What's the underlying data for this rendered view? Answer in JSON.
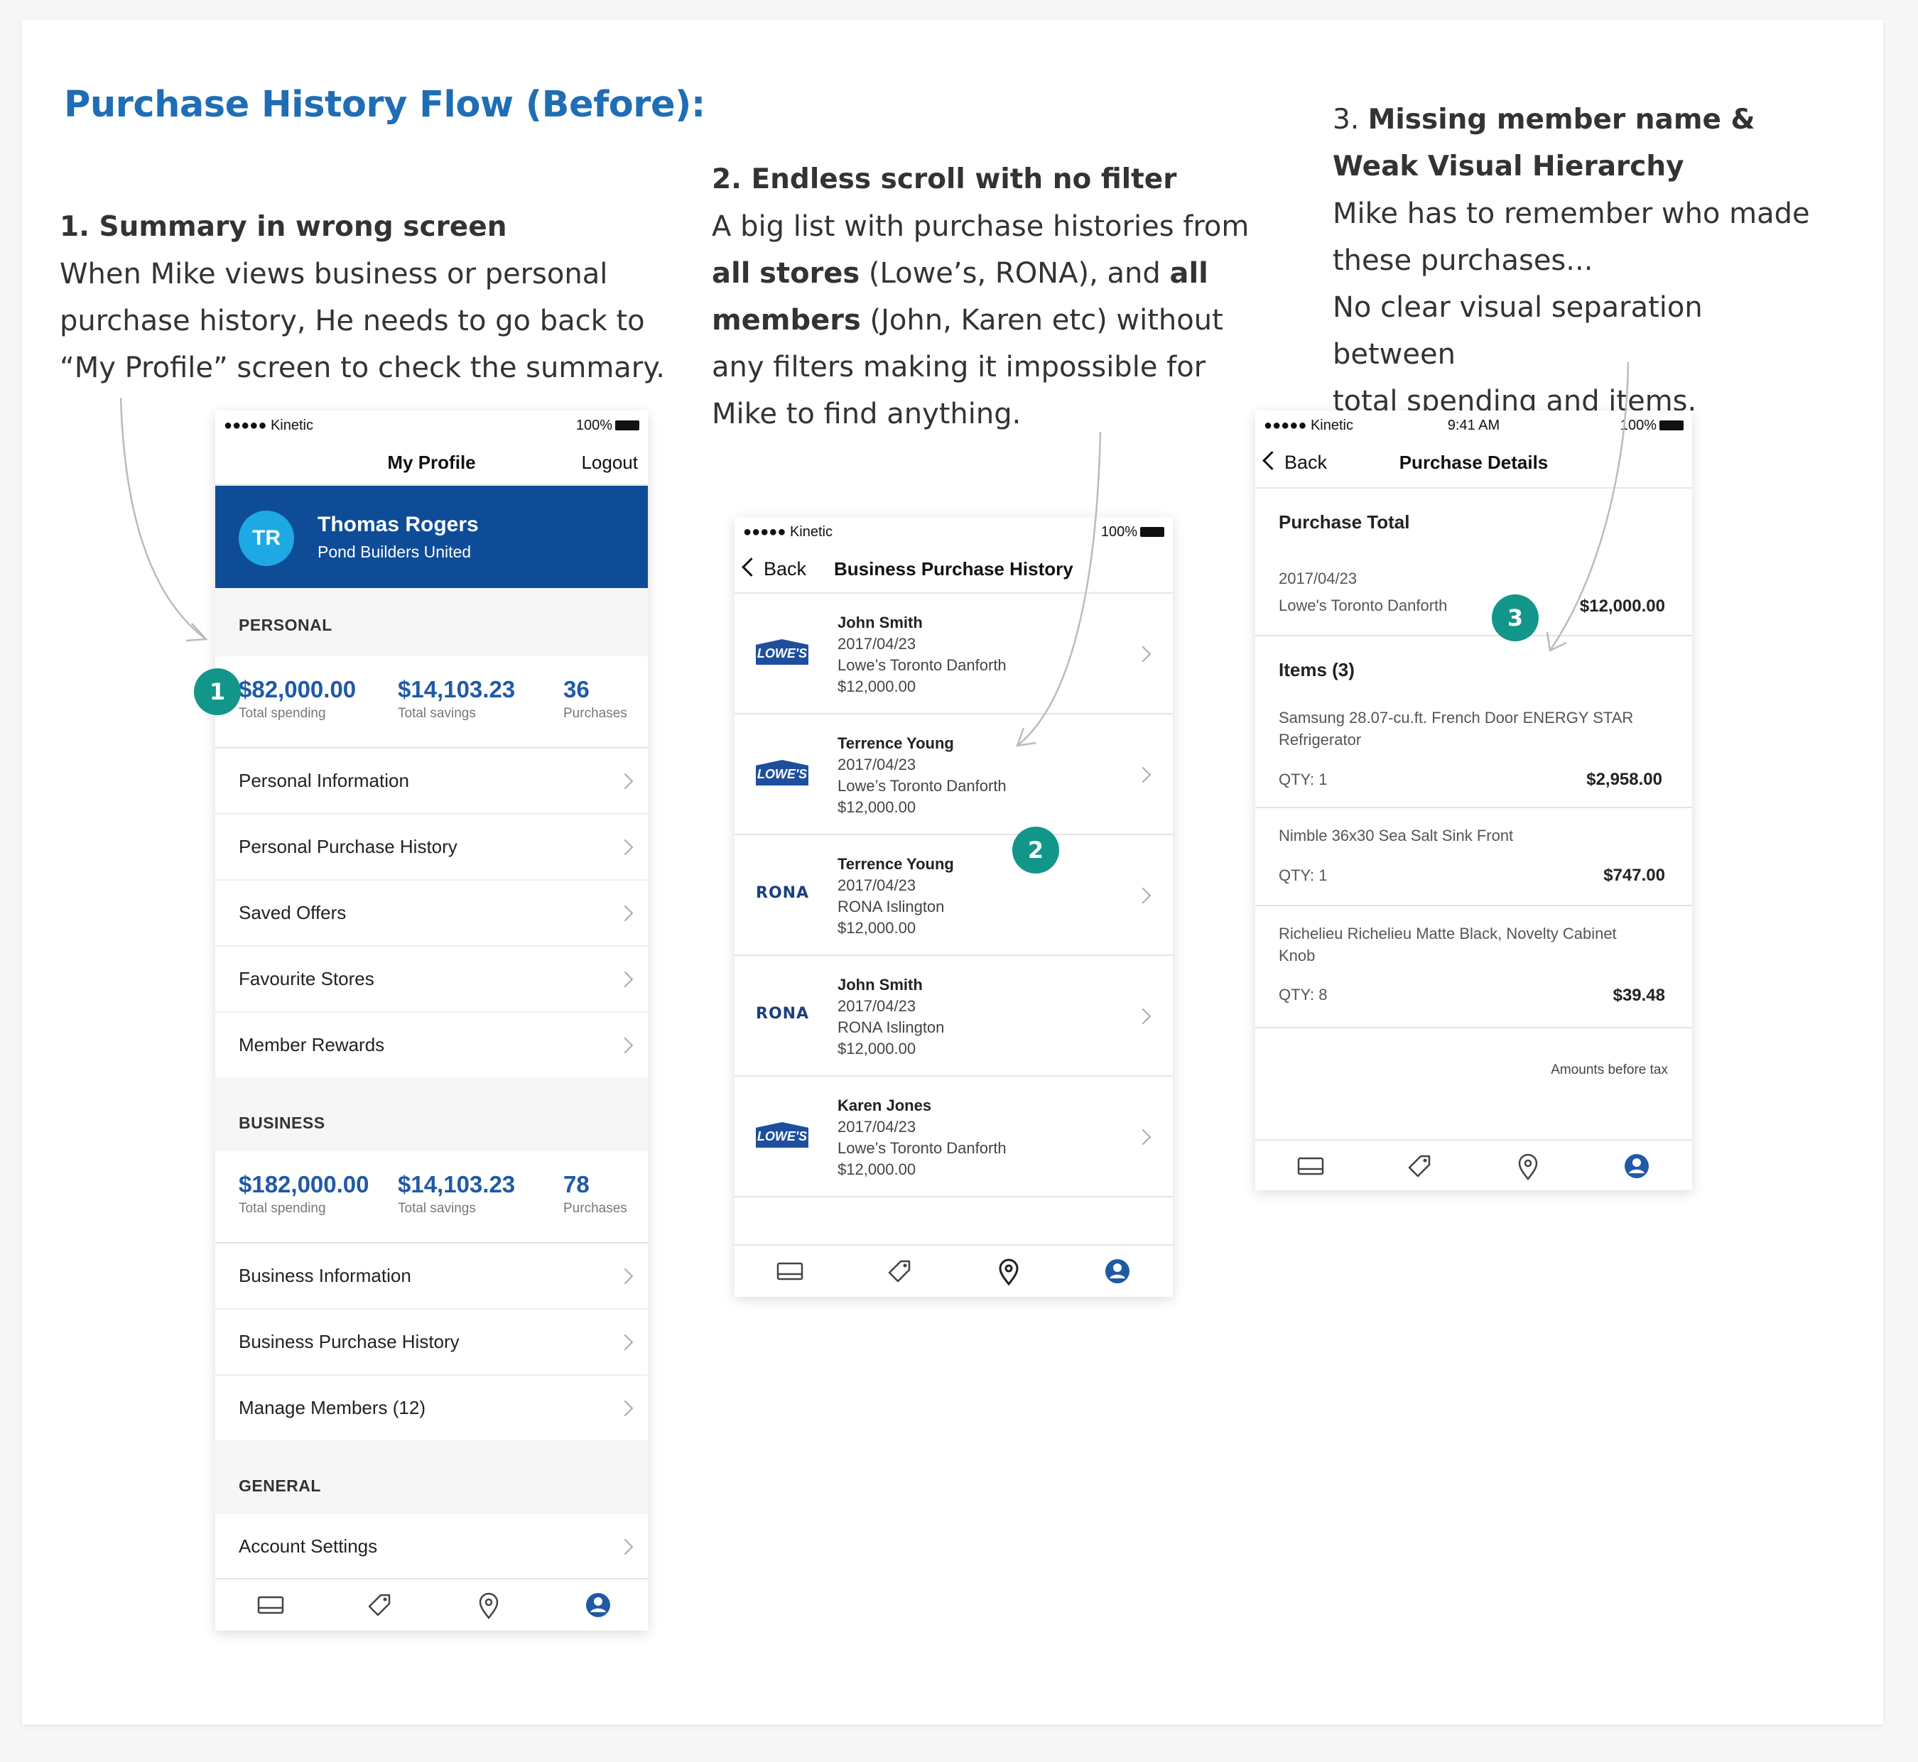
{
  "page": {
    "title": "Purchase History Flow (Before):"
  },
  "notes": [
    {
      "heading": "1. Summary in wrong screen",
      "body": [
        "When Mike views business or personal",
        "purchase history, He needs to go back to",
        "“My Profile” screen to check the summary."
      ]
    },
    {
      "heading": "2. Endless scroll with no filter",
      "body_parts": [
        "A big list with purchase histories from ",
        "all",
        " ",
        "stores",
        " (Lowe’s, RONA), and ",
        "all members",
        " (John, Karen etc)  without any filters making it impossible for Mike to find anything."
      ]
    },
    {
      "heading_num": "3. ",
      "heading": "Missing member name & Weak Visual Hierarchy",
      "body": [
        "Mike has to remember who made",
        "these purchases...",
        "No clear visual separation between",
        "total spending and items."
      ]
    }
  ],
  "badges": [
    "1",
    "2",
    "3"
  ],
  "status": {
    "carrier": "●●●●● Kinetic",
    "battery": "100%",
    "time": "9:41 AM"
  },
  "profile": {
    "nav_title": "My Profile",
    "logout": "Logout",
    "initials": "TR",
    "name": "Thomas Rogers",
    "company": "Pond Builders United",
    "personal": {
      "header": "PERSONAL",
      "spending": "$82,000.00",
      "spending_label": "Total spending",
      "savings": "$14,103.23",
      "savings_label": "Total savings",
      "purchases": "36",
      "purchases_label": "Purchases",
      "rows": [
        "Personal Information",
        "Personal Purchase History",
        "Saved Offers",
        "Favourite Stores",
        "Member Rewards"
      ]
    },
    "business": {
      "header": "BUSINESS",
      "spending": "$182,000.00",
      "spending_label": "Total spending",
      "savings": "$14,103.23",
      "savings_label": "Total savings",
      "purchases": "78",
      "purchases_label": "Purchases",
      "rows": [
        "Business Information",
        "Business Purchase History",
        "Manage Members (12)"
      ]
    },
    "general": {
      "header": "GENERAL",
      "rows": [
        "Account Settings"
      ]
    }
  },
  "history": {
    "back": "Back",
    "nav_title": "Business Purchase History",
    "items": [
      {
        "store_logo": "LOWE'S",
        "name": "John Smith",
        "date": "2017/04/23",
        "store": "Lowe’s Toronto Danforth",
        "amount": "$12,000.00"
      },
      {
        "store_logo": "LOWE'S",
        "name": "Terrence Young",
        "date": "2017/04/23",
        "store": "Lowe’s Toronto Danforth",
        "amount": "$12,000.00"
      },
      {
        "store_logo": "RONA",
        "name": "Terrence Young",
        "date": "2017/04/23",
        "store": "RONA Islington",
        "amount": "$12,000.00"
      },
      {
        "store_logo": "RONA",
        "name": "John Smith",
        "date": "2017/04/23",
        "store": "RONA Islington",
        "amount": "$12,000.00"
      },
      {
        "store_logo": "LOWE'S",
        "name": "Karen Jones",
        "date": "2017/04/23",
        "store": "Lowe’s Toronto Danforth",
        "amount": "$12,000.00"
      }
    ]
  },
  "details": {
    "back": "Back",
    "nav_title": "Purchase Details",
    "total_label": "Purchase Total",
    "date": "2017/04/23",
    "store": "Lowe's Toronto Danforth",
    "total": "$12,000.00",
    "items_label": "Items (3)",
    "items": [
      {
        "line1": "Samsung 28.07-cu.ft. French Door ENERGY STAR",
        "line2": "Refrigerator",
        "qty": "QTY:  1",
        "price": "$2,958.00"
      },
      {
        "line1": "Nimble 36x30 Sea Salt Sink Front",
        "line2": "",
        "qty": "QTY:  1",
        "price": "$747.00"
      },
      {
        "line1": "Richelieu Richelieu Matte Black, Novelty Cabinet",
        "line2": "Knob",
        "qty": "QTY:  8",
        "price": "$39.48"
      }
    ],
    "tax_note": "Amounts before tax"
  },
  "tabs": [
    "card-icon",
    "tag-icon",
    "location-pin-icon",
    "profile-icon"
  ],
  "colors": {
    "title_blue": "#1f6db5",
    "brand_blue": "#0e4c98",
    "value_blue": "#1f5aa6",
    "badge_teal": "#12968a",
    "avatar_cyan": "#1da9e4"
  }
}
